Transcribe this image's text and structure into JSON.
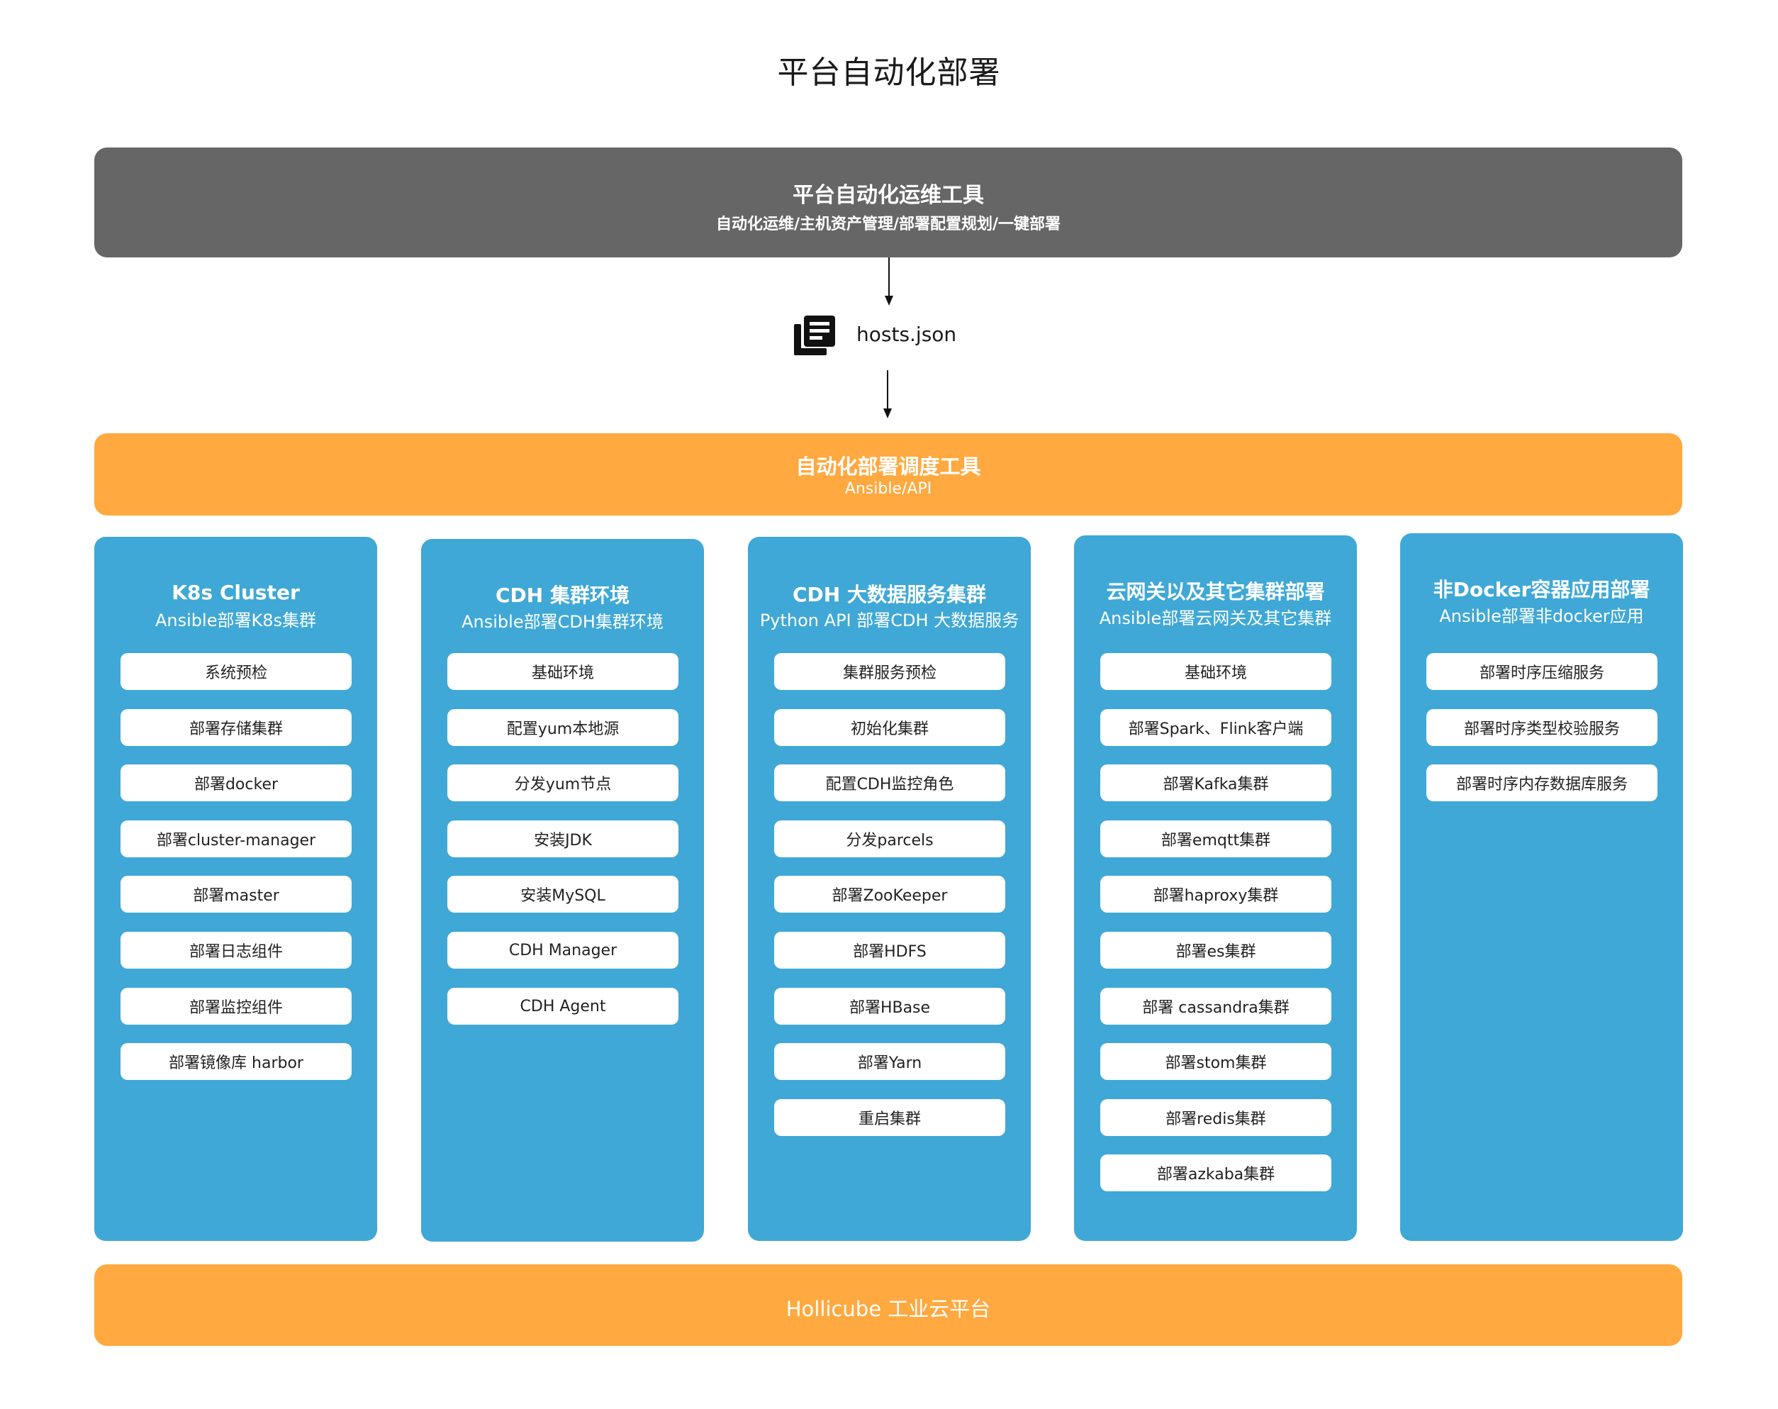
{
  "title": "平台自动化部署",
  "ops_tool": {
    "title": "平台自动化运维工具",
    "subtitle": "自动化运维/主机资产管理/部署配置规划/一键部署"
  },
  "hosts_file": {
    "icon": "document-list-icon",
    "label": "hosts.json"
  },
  "scheduler": {
    "title": "自动化部署调度工具",
    "subtitle": "Ansible/API"
  },
  "columns": [
    {
      "title": "K8s Cluster",
      "subtitle": "Ansible部署K8s集群",
      "items": [
        "系统预检",
        "部署存储集群",
        "部署docker",
        "部署cluster-manager",
        "部署master",
        "部署日志组件",
        "部署监控组件",
        "部署镜像库 harbor"
      ]
    },
    {
      "title": "CDH 集群环境",
      "subtitle": "Ansible部署CDH集群环境",
      "items": [
        "基础环境",
        "配置yum本地源",
        "分发yum节点",
        "安装JDK",
        "安装MySQL",
        "CDH Manager",
        "CDH Agent"
      ]
    },
    {
      "title": "CDH 大数据服务集群",
      "subtitle": "Python API 部署CDH 大数据服务",
      "items": [
        "集群服务预检",
        "初始化集群",
        "配置CDH监控角色",
        "分发parcels",
        "部署ZooKeeper",
        "部署HDFS",
        "部署HBase",
        "部署Yarn",
        "重启集群"
      ]
    },
    {
      "title": "云网关以及其它集群部署",
      "subtitle": "Ansible部署云网关及其它集群",
      "items": [
        "基础环境",
        "部署Spark、Flink客户端",
        "部署Kafka集群",
        "部署emqtt集群",
        "部署haproxy集群",
        "部署es集群",
        "部署 cassandra集群",
        "部署stom集群",
        "部署redis集群",
        "部署azkaba集群"
      ]
    },
    {
      "title": "非Docker容器应用部署",
      "subtitle": "Ansible部署非docker应用",
      "items": [
        "部署时序压缩服务",
        "部署时序类型校验服务",
        "部署时序内存数据库服务"
      ]
    }
  ],
  "platform": {
    "title": "Hollicube 工业云平台"
  },
  "colors": {
    "ops_bar": "#666666",
    "orange": "#ffa940",
    "column_blue": "#3fa8d6",
    "item_bg": "#ffffff"
  }
}
